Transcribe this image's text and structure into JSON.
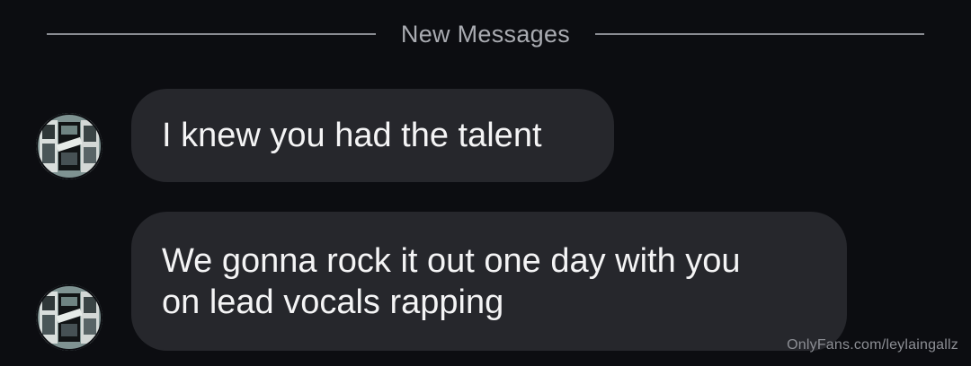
{
  "divider": {
    "label": "New Messages"
  },
  "messages": [
    {
      "text": "I knew you had the talent",
      "avatar_icon": "profile-avatar"
    },
    {
      "text": "We gonna rock it out one day with you\non lead vocals rapping",
      "avatar_icon": "profile-avatar"
    }
  ],
  "watermark": {
    "text": "OnlyFans.com/leylaingallz"
  },
  "colors": {
    "background": "#0c0d11",
    "bubble": "#26272c",
    "divider": "#8a8c92",
    "divider_text": "#a9abb1",
    "message_text": "#f4f4f5"
  }
}
